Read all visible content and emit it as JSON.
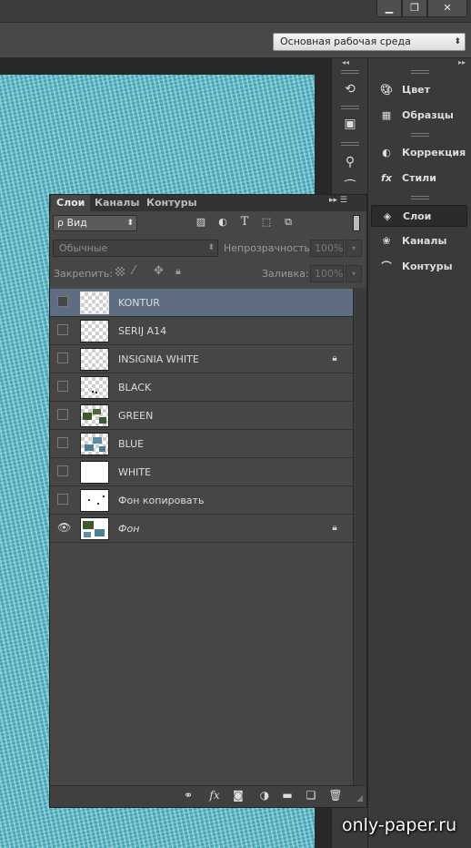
{
  "window": {
    "min_label": "▁",
    "restore_label": "❐",
    "close_label": "✕"
  },
  "workspace": {
    "label": "Основная рабочая среда",
    "arrow": "⬍"
  },
  "dock_strip": {
    "collapse_label": "◂◂"
  },
  "right_dock": {
    "collapse_label": "▸▸",
    "items": [
      {
        "label": "Цвет",
        "icon": "palette-icon"
      },
      {
        "label": "Образцы",
        "icon": "swatches-grid-icon"
      },
      {
        "label": "Коррекция",
        "icon": "adjustments-icon"
      },
      {
        "label": "Стили",
        "icon": "fx-styles-icon"
      },
      {
        "label": "Слои",
        "icon": "layers-icon",
        "active": true
      },
      {
        "label": "Каналы",
        "icon": "channels-icon"
      },
      {
        "label": "Контуры",
        "icon": "paths-icon"
      }
    ]
  },
  "layers_panel": {
    "tabs": [
      "Слои",
      "Каналы",
      "Контуры"
    ],
    "menu_label": "▸▸ ☰",
    "filter": {
      "label": "ρ Вид",
      "arrow": "⬍"
    },
    "blend_mode": "Обычные",
    "opacity_label": "Непрозрачность:",
    "opacity_value": "100%",
    "lock_label": "Закрепить:",
    "fill_label": "Заливка:",
    "fill_value": "100%",
    "layers": [
      {
        "name": "KONTUR",
        "visible": false,
        "locked": false,
        "selected": true,
        "italic": false
      },
      {
        "name": "SERIJ A14",
        "visible": false,
        "locked": false,
        "selected": false,
        "italic": false
      },
      {
        "name": "INSIGNIA WHITE",
        "visible": false,
        "locked": true,
        "selected": false,
        "italic": false
      },
      {
        "name": "BLACK",
        "visible": false,
        "locked": false,
        "selected": false,
        "italic": false
      },
      {
        "name": "GREEN",
        "visible": false,
        "locked": false,
        "selected": false,
        "italic": false
      },
      {
        "name": "BLUE",
        "visible": false,
        "locked": false,
        "selected": false,
        "italic": false
      },
      {
        "name": "WHITE",
        "visible": false,
        "locked": false,
        "selected": false,
        "italic": false
      },
      {
        "name": "Фон копировать",
        "visible": false,
        "locked": false,
        "selected": false,
        "italic": false
      },
      {
        "name": "Фон",
        "visible": true,
        "locked": true,
        "selected": false,
        "italic": true
      }
    ]
  },
  "watermark": "only-paper.ru",
  "colors": {
    "selected_row": "#5f6d82",
    "canvas": "#58bcc4",
    "panel": "#464646"
  }
}
